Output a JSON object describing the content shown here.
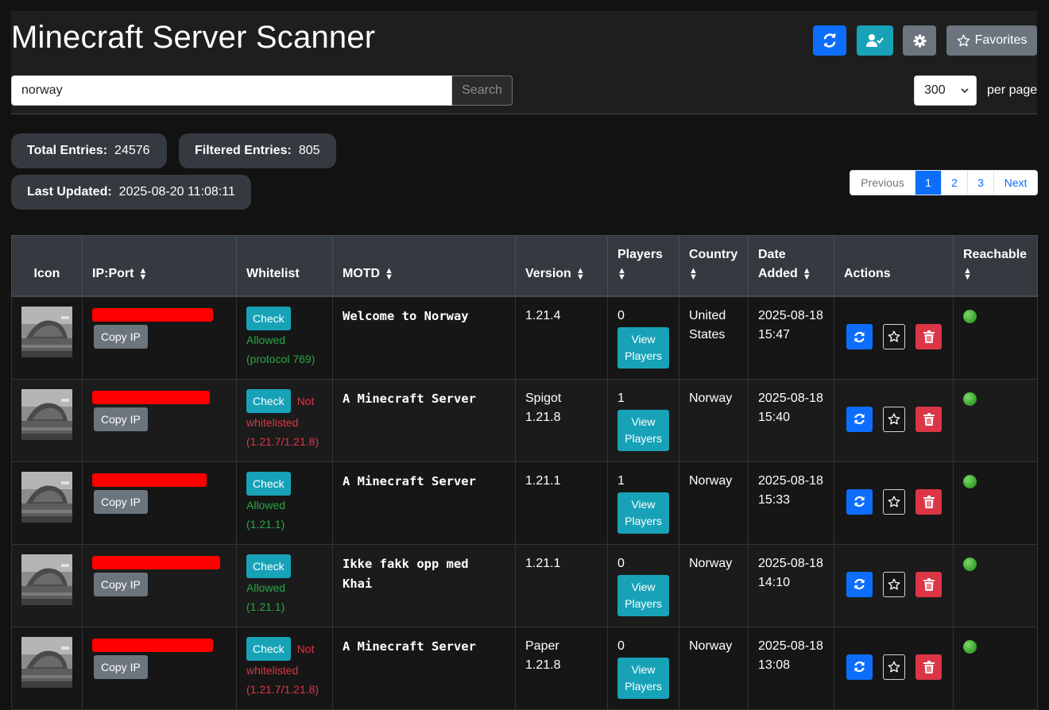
{
  "header": {
    "title": "Minecraft Server Scanner",
    "favorites_label": "Favorites"
  },
  "search": {
    "value": "norway",
    "button_label": "Search"
  },
  "per_page": {
    "value": "300",
    "label": "per page"
  },
  "stats": {
    "total_label": "Total Entries:",
    "total_value": "24576",
    "filtered_label": "Filtered Entries:",
    "filtered_value": "805",
    "updated_label": "Last Updated:",
    "updated_value": "2025-08-20 11:08:11"
  },
  "pagination": {
    "previous": "Previous",
    "pages": [
      "1",
      "2",
      "3"
    ],
    "active_page": "1",
    "next": "Next"
  },
  "table": {
    "headers": {
      "icon": "Icon",
      "ip": "IP:Port",
      "whitelist": "Whitelist",
      "motd": "MOTD",
      "version": "Version",
      "players": "Players",
      "country": "Country",
      "date": "Date Added",
      "actions": "Actions",
      "reachable": "Reachable"
    },
    "copy_label": "Copy IP",
    "check_label": "Check",
    "view_label_1": "View",
    "view_label_2": "Players",
    "rows": [
      {
        "wl_status": "ok",
        "wl_line1": "Allowed",
        "wl_line2": "(protocol 769)",
        "motd": "Welcome to Norway",
        "version": "1.21.4",
        "players": "0",
        "country": "United States",
        "date_day": "2025-08-18",
        "date_time": "15:47"
      },
      {
        "wl_status": "bad",
        "wl_line1": "Not whitelisted",
        "wl_line2": "(1.21.7/1.21.8)",
        "motd": "A Minecraft Server",
        "version": "Spigot 1.21.8",
        "players": "1",
        "country": "Norway",
        "date_day": "2025-08-18",
        "date_time": "15:40"
      },
      {
        "wl_status": "ok",
        "wl_line1": "Allowed",
        "wl_line2": "(1.21.1)",
        "motd": "A Minecraft Server",
        "version": "1.21.1",
        "players": "1",
        "country": "Norway",
        "date_day": "2025-08-18",
        "date_time": "15:33"
      },
      {
        "wl_status": "ok",
        "wl_line1": "Allowed",
        "wl_line2": "(1.21.1)",
        "motd": "Ikke fakk opp med Khai",
        "version": "1.21.1",
        "players": "0",
        "country": "Norway",
        "date_day": "2025-08-18",
        "date_time": "14:10"
      },
      {
        "wl_status": "bad",
        "wl_line1": "Not whitelisted",
        "wl_line2": "(1.21.7/1.21.8)",
        "motd": "A Minecraft Server",
        "version": "Paper 1.21.8",
        "players": "0",
        "country": "Norway",
        "date_day": "2025-08-18",
        "date_time": "13:08"
      }
    ]
  },
  "colors": {
    "primary": "#0d6efd",
    "info": "#17a2b8",
    "secondary": "#6c757d",
    "danger": "#dc3545",
    "success": "#28a745",
    "redaction": "#ff0000"
  }
}
